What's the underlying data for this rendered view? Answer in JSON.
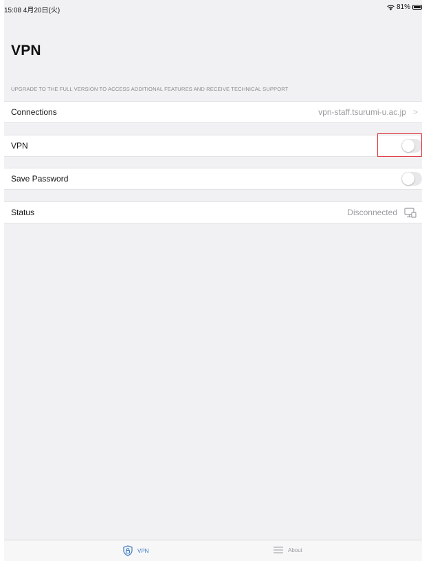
{
  "status_bar": {
    "time": "15:08  4月20日(火)",
    "battery": "81%",
    "wifi_icon": "wifi-icon",
    "battery_icon": "battery-icon"
  },
  "page": {
    "title": "VPN",
    "upgrade_note": "UPGRADE TO THE FULL VERSION TO ACCESS ADDITIONAL FEATURES AND RECEIVE TECHNICAL SUPPORT"
  },
  "settings": {
    "connections": {
      "label": "Connections",
      "value": "vpn-staff.tsurumi-u.ac.jp",
      "chevron": ">"
    },
    "vpn": {
      "label": "VPN",
      "enabled": false
    },
    "save_password": {
      "label": "Save Password",
      "enabled": false
    },
    "status": {
      "label": "Status",
      "value": "Disconnected",
      "icon": "monitor-icon"
    }
  },
  "tab_bar": {
    "tabs": [
      {
        "label": "VPN",
        "icon": "lock-shield-icon",
        "active": true
      },
      {
        "label": "About",
        "icon": "list-icon",
        "active": false
      }
    ]
  },
  "colors": {
    "accent": "#3a78c4",
    "highlight": "#e0393e",
    "background": "#f1f1f3"
  }
}
